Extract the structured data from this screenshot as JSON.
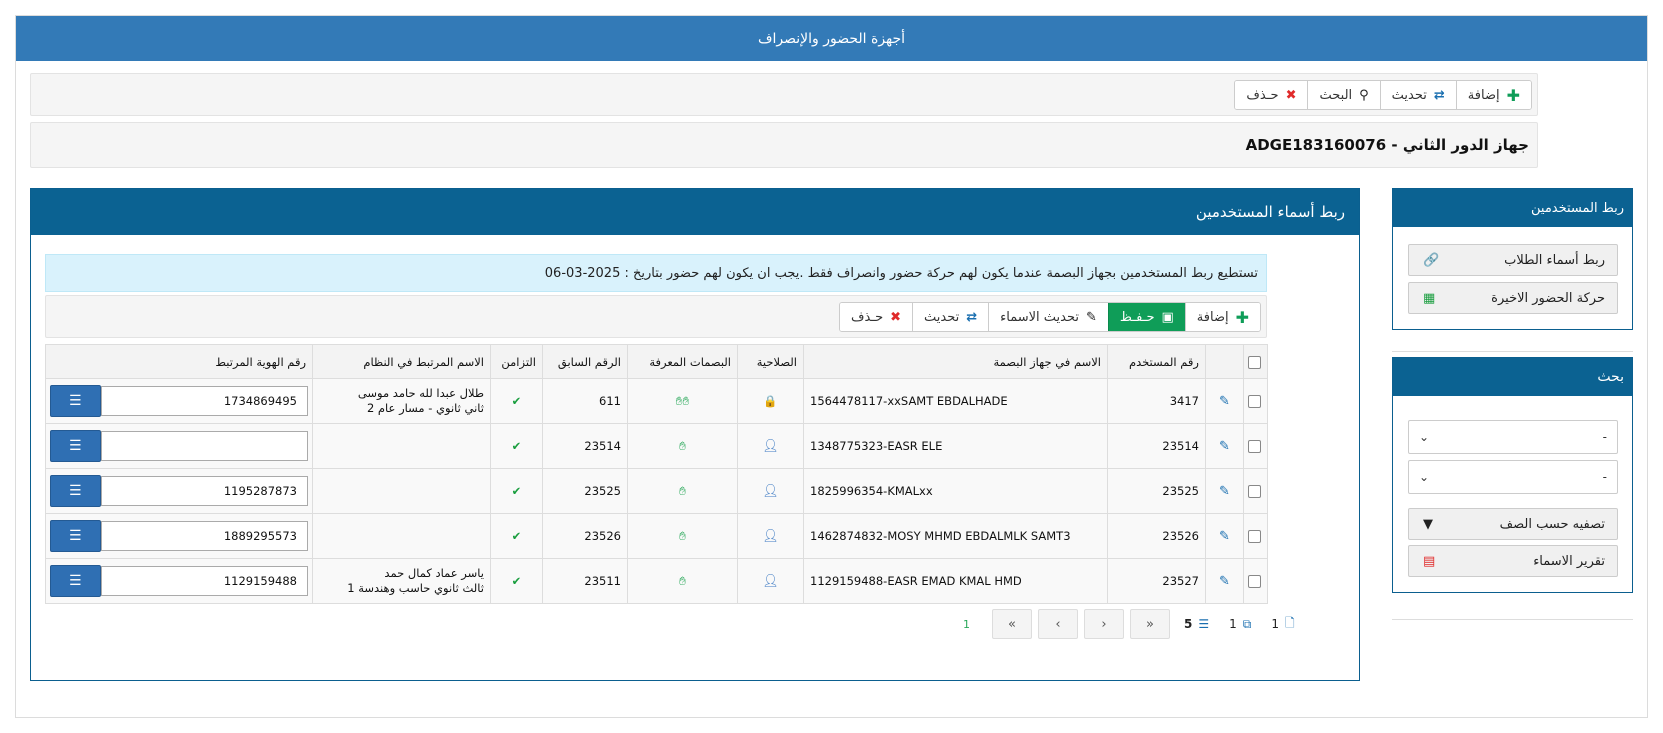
{
  "header": {
    "title": "أجهزة الحضور والإنصراف"
  },
  "toolbar": {
    "add": "إضافة",
    "refresh": "تحديث",
    "search": "البحث",
    "delete": "حـذف"
  },
  "device": {
    "title": "ADGE183160076 - جهاز الدور الثاني"
  },
  "main_panel": {
    "title": "ربط أسماء المستخدمين",
    "alert": "تستطيع ربط المستخدمين بجهاز البصمة عندما يكون لهم حركة حضور وانصراف فقط .يجب ان يكون لهم حضور بتاريخ : 2025-03-06",
    "buttons": {
      "add": "إضافة",
      "save": "حـفـظ",
      "update_names": "تحديث الاسماء",
      "refresh": "تحديث",
      "delete": "حـذف"
    }
  },
  "table": {
    "headers": {
      "user_no": "رقم المستخدم",
      "device_name": "الاسم في جهاز البصمة",
      "permission": "الصلاحية",
      "fingerprints": "البصمات المعرفة",
      "prev_no": "الرقم السابق",
      "sync": "التزامن",
      "linked_name": "الاسم المرتبط في النظام",
      "linked_id": "رقم الهوية المرتبط"
    },
    "rows": [
      {
        "user_no": "3417",
        "device_name": "1564478117-xxSAMT EBDALHADE",
        "permission": "admin",
        "fingers": 2,
        "prev_no": "611",
        "name1": "طلال عبدا لله حامد موسى",
        "name2": "ثاني ثانوي - مسار عام 2",
        "id": "1734869495"
      },
      {
        "user_no": "23514",
        "device_name": "1348775323-EASR ELE",
        "permission": "user",
        "fingers": 1,
        "prev_no": "23514",
        "name1": "",
        "name2": "",
        "id": ""
      },
      {
        "user_no": "23525",
        "device_name": "1825996354-KMALxx",
        "permission": "user",
        "fingers": 1,
        "prev_no": "23525",
        "name1": "",
        "name2": "",
        "id": "1195287873"
      },
      {
        "user_no": "23526",
        "device_name": "1462874832-MOSY MHMD EBDALMLK SAMT3",
        "permission": "user",
        "fingers": 1,
        "prev_no": "23526",
        "name1": "",
        "name2": "",
        "id": "1889295573"
      },
      {
        "user_no": "23527",
        "device_name": "1129159488-EASR EMAD KMAL HMD",
        "permission": "user",
        "fingers": 1,
        "prev_no": "23511",
        "name1": "ياسر عماد كمال حمد",
        "name2": "ثالث ثانوي حاسب وهندسة 1",
        "id": "1129159488"
      }
    ]
  },
  "pager": {
    "current": "1",
    "per_page": "5",
    "pages": "1",
    "total": "1"
  },
  "sidebar": {
    "link_panel": {
      "title": "ربط المستخدمين",
      "link_students": "ربط أسماء الطلاب",
      "recent_attendance": "حركة الحضور الاخيرة"
    },
    "search_panel": {
      "title": "بحث",
      "select1": "-",
      "select2": "-",
      "filter_class": "تصفيه حسب الصف",
      "names_report": "تقرير الاسماء"
    }
  },
  "colors": {
    "header_bg": "#337ab7",
    "panel_head": "#0b6292",
    "save_green": "#0f9d58",
    "alert_bg": "#d9f2fc"
  }
}
